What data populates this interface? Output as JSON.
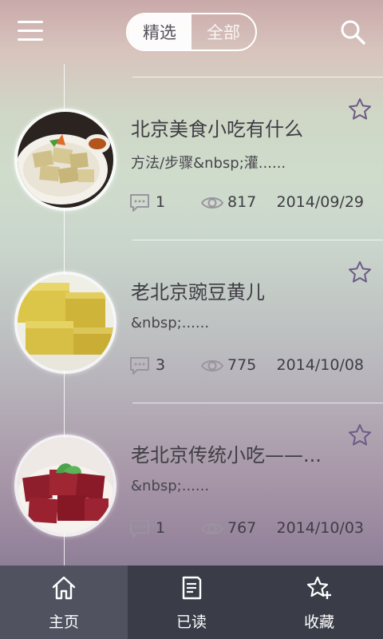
{
  "header": {
    "tabs": [
      {
        "label": "精选",
        "active": true
      },
      {
        "label": "全部",
        "active": false
      }
    ],
    "menu_icon": "hamburger-menu-icon",
    "search_icon": "search-icon"
  },
  "articles": [
    {
      "title": "北京美食小吃有什么",
      "summary": "方法/步骤&nbsp;灌......",
      "comments": "1",
      "views": "817",
      "date": "2014/09/29"
    },
    {
      "title": "老北京豌豆黄儿",
      "summary": "&nbsp;......",
      "comments": "3",
      "views": "775",
      "date": "2014/10/08"
    },
    {
      "title": "老北京传统小吃——...",
      "summary": "&nbsp;......",
      "comments": "1",
      "views": "767",
      "date": "2014/10/03"
    }
  ],
  "bottom_nav": [
    {
      "label": "主页",
      "icon": "home-icon",
      "active": true
    },
    {
      "label": "已读",
      "icon": "document-icon",
      "active": false
    },
    {
      "label": "收藏",
      "icon": "star-add-icon",
      "active": false
    }
  ],
  "colors": {
    "nav_background": "#3a3c48",
    "nav_active": "#505260",
    "star_outline": "#6e5a86",
    "text_dark": "#3f3d44"
  }
}
